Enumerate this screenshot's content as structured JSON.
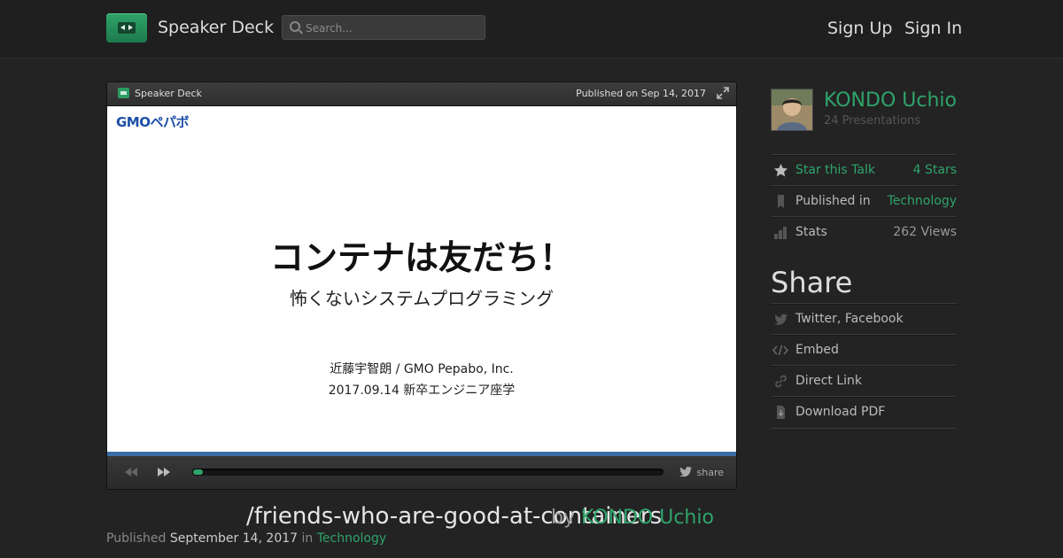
{
  "header": {
    "brand": "Speaker Deck",
    "search_placeholder": "Search...",
    "sign_up": "Sign Up",
    "sign_in": "Sign In"
  },
  "player": {
    "brand": "Speaker Deck",
    "published": "Published on Sep 14, 2017",
    "share_label": "share",
    "progress_fraction": 0.02,
    "slide": {
      "logo_text": "GMOペパボ",
      "title": "コンテナは友だち！",
      "subtitle": "怖くないシステムプログラミング",
      "author_line": "近藤宇智朗 / GMO Pepabo, Inc.",
      "date_line": "2017.09.14 新卒エンジニア座学"
    }
  },
  "talk": {
    "slug": "/friends-who-are-good-at-containers",
    "by_prefix": "by",
    "by_author": "KONDO Uchio",
    "published_label": "Published",
    "published_date": "September 14, 2017",
    "in_label": "in",
    "category": "Technology"
  },
  "sidebar": {
    "author_name": "KONDO Uchio",
    "author_presentations": "24 Presentations",
    "star_label": "Star this Talk",
    "star_count": "4 Stars",
    "published_in_label": "Published in",
    "published_in_value": "Technology",
    "stats_label": "Stats",
    "stats_value": "262 Views",
    "share_heading": "Share",
    "share_items": [
      "Twitter, Facebook",
      "Embed",
      "Direct Link",
      "Download PDF"
    ]
  },
  "colors": {
    "background": "#232323",
    "accent": "#2fa36a",
    "slide_bar": "#3b6ea5"
  },
  "icons": [
    "play-logo-icon",
    "search-icon",
    "expand-icon",
    "prev-slide-icon",
    "next-slide-icon",
    "twitter-bird-icon",
    "star-icon",
    "bookmark-icon",
    "stats-icon",
    "embed-icon",
    "link-icon",
    "download-pdf-icon"
  ]
}
